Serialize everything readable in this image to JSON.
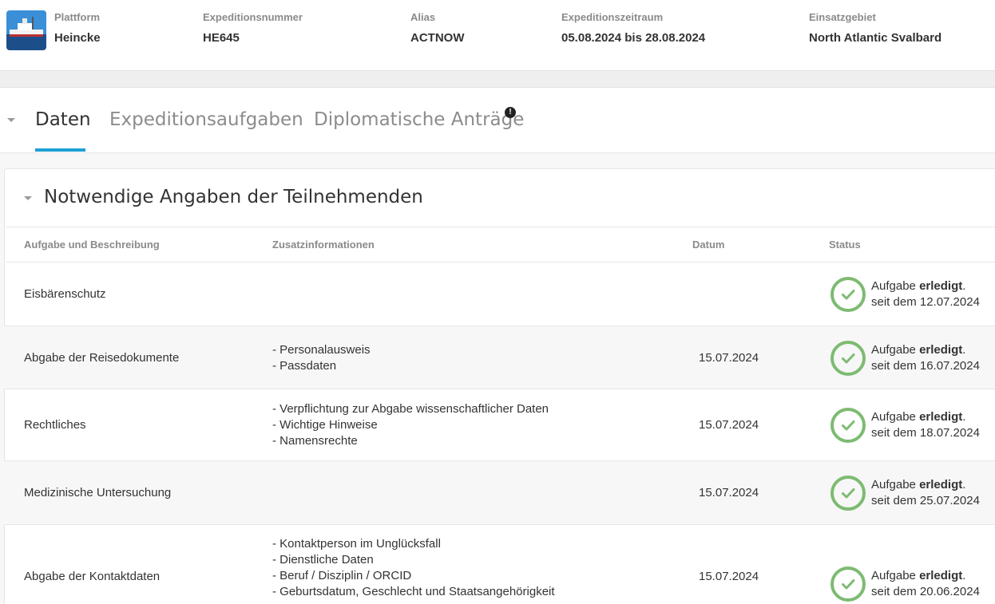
{
  "header": {
    "fields": [
      {
        "label": "Plattform",
        "value": "Heincke"
      },
      {
        "label": "Expeditionsnummer",
        "value": "HE645"
      },
      {
        "label": "Alias",
        "value": "ACTNOW"
      },
      {
        "label": "Expeditionszeitraum",
        "value": "05.08.2024 bis 28.08.2024"
      },
      {
        "label": "Einsatzgebiet",
        "value": "North Atlantic Svalbard"
      }
    ]
  },
  "tabs": [
    {
      "label": "Daten",
      "active": true
    },
    {
      "label": "Expeditionsaufgaben",
      "active": false
    },
    {
      "label": "Diplomatische Anträge",
      "active": false,
      "badge": "!"
    }
  ],
  "section": {
    "title": "Notwendige Angaben der Teilnehmenden",
    "columns": [
      "Aufgabe und Beschreibung",
      "Zusatzinformationen",
      "Datum",
      "Status"
    ],
    "rows": [
      {
        "task": "Eisbärenschutz",
        "info": [],
        "date": "",
        "status_prefix": "Aufgabe ",
        "status_bold": "erledigt",
        "status_suffix": ".",
        "status_since": "seit dem 12.07.2024"
      },
      {
        "task": "Abgabe der Reisedokumente",
        "info": [
          "- Personalausweis",
          "- Passdaten"
        ],
        "date": "15.07.2024",
        "status_prefix": "Aufgabe ",
        "status_bold": "erledigt",
        "status_suffix": ".",
        "status_since": "seit dem 16.07.2024"
      },
      {
        "task": "Rechtliches",
        "info": [
          "- Verpflichtung zur Abgabe wissenschaftlicher Daten",
          "- Wichtige Hinweise",
          "- Namensrechte"
        ],
        "date": "15.07.2024",
        "status_prefix": "Aufgabe ",
        "status_bold": "erledigt",
        "status_suffix": ".",
        "status_since": "seit dem 18.07.2024"
      },
      {
        "task": "Medizinische Untersuchung",
        "info": [],
        "date": "15.07.2024",
        "status_prefix": "Aufgabe ",
        "status_bold": "erledigt",
        "status_suffix": ".",
        "status_since": "seit dem 25.07.2024"
      },
      {
        "task": "Abgabe der Kontaktdaten",
        "info": [
          "- Kontaktperson im Unglücksfall",
          "- Dienstliche Daten",
          "- Beruf / Disziplin / ORCID",
          "- Geburtsdatum, Geschlecht und Staatsangehörigkeit"
        ],
        "date": "15.07.2024",
        "status_prefix": "Aufgabe ",
        "status_bold": "erledigt",
        "status_suffix": ".",
        "status_since": "seit dem 20.06.2024"
      }
    ]
  },
  "colors": {
    "accent": "#1da1d4",
    "success": "#7dbb72"
  },
  "icons": {
    "platform": "ship-thumbnail",
    "status": "check-circle-icon",
    "collapse": "caret-down-icon",
    "alert": "exclamation-badge-icon"
  }
}
